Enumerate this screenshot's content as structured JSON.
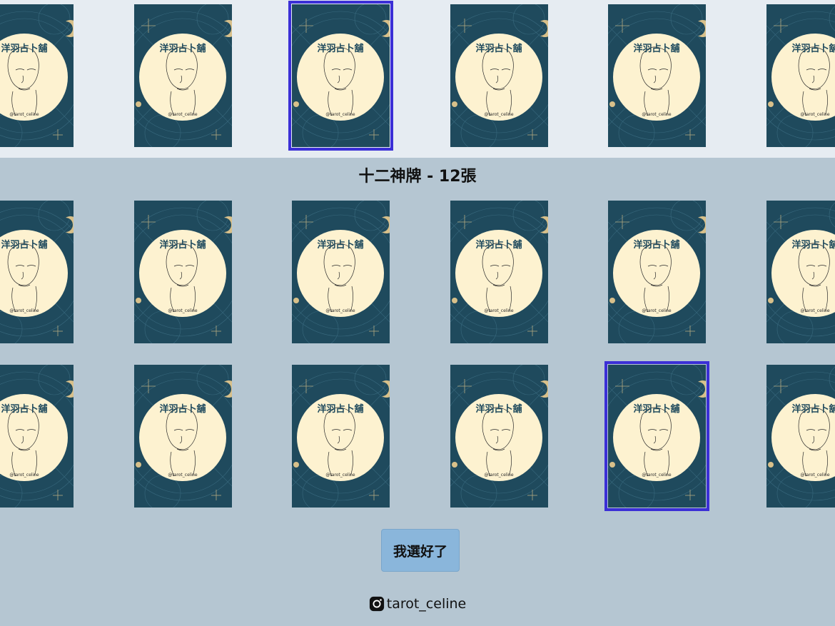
{
  "section_title": "十二神牌 - 12張",
  "card_back": {
    "shop_name": "洋羽占卜舖",
    "handle": "@tarot_celine",
    "colors": {
      "background": "#1f4a5d",
      "circle": "#fdf2d0",
      "gold": "#d8c08a",
      "line": "#2b2b2b"
    }
  },
  "selection_color": "#3b2fd6",
  "cards": {
    "top_row": [
      {
        "selected": false
      },
      {
        "selected": false
      },
      {
        "selected": true
      },
      {
        "selected": false
      },
      {
        "selected": false
      },
      {
        "selected": false
      }
    ],
    "row_1": [
      {
        "selected": false
      },
      {
        "selected": false
      },
      {
        "selected": false
      },
      {
        "selected": false
      },
      {
        "selected": false
      },
      {
        "selected": false
      }
    ],
    "row_2": [
      {
        "selected": false
      },
      {
        "selected": false
      },
      {
        "selected": false
      },
      {
        "selected": false
      },
      {
        "selected": true
      },
      {
        "selected": false
      }
    ]
  },
  "confirm_button_label": "我選好了",
  "footer": {
    "icon": "instagram-icon",
    "text": "tarot_celine"
  }
}
